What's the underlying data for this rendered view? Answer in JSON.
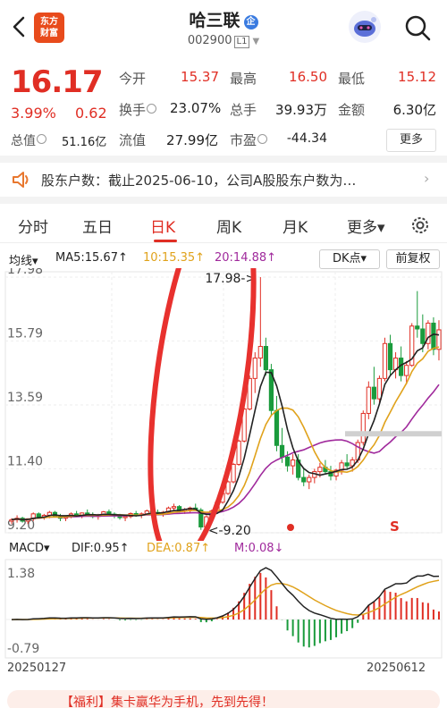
{
  "header": {
    "logo_line1": "东方",
    "logo_line2": "财富",
    "title": "哈三联",
    "title_badge": "企",
    "code": "002900",
    "level": "L1"
  },
  "quote": {
    "price": "16.17",
    "change_pct": "3.99%",
    "change_amt": "0.62",
    "open_label": "今开",
    "open": "15.37",
    "high_label": "最高",
    "high": "16.50",
    "low_label": "最低",
    "low": "15.12",
    "turnover_label": "换手",
    "turnover": "23.07%",
    "volume_label": "总手",
    "volume": "39.93万",
    "amount_label": "金额",
    "amount": "6.30亿",
    "mcap_label": "总值",
    "mcap": "51.16亿",
    "float_label": "流值",
    "float": "27.99亿",
    "pe_label": "市盈",
    "pe": "-44.34",
    "more": "更多"
  },
  "notice": {
    "text": "股东户数：截止2025-06-10，公司A股股东户数为…",
    "arrow": "›"
  },
  "tabs": [
    {
      "label": "分时"
    },
    {
      "label": "五日"
    },
    {
      "label": "日K"
    },
    {
      "label": "周K"
    },
    {
      "label": "月K"
    },
    {
      "label": "更多▾"
    }
  ],
  "indicators": {
    "ma_type": "均线▾",
    "ma5": "MA5:15.67↑",
    "ma10": "10:15.35↑",
    "ma20": "20:14.88↑",
    "dk": "DK点▾",
    "adjust": "前复权"
  },
  "macd": {
    "label": "MACD▾",
    "dif": "DIF:0.95↑",
    "dea": "DEA:0.87↑",
    "m": "M:0.08↓",
    "ymax": "1.38",
    "ymin": "-0.79"
  },
  "dates": {
    "start": "20250127",
    "end": "20250612"
  },
  "banner": "【福利】集卡赢华为手机，先到先得！",
  "chart_data": {
    "type": "candlestick",
    "y_ticks": [
      "17.98",
      "15.79",
      "13.59",
      "11.40",
      "9.20"
    ],
    "ylim": [
      9.2,
      17.98
    ],
    "annotations": {
      "high": "17.98->",
      "low": "<-9.20"
    },
    "signal": "S",
    "colors": {
      "up": "#e02e24",
      "down": "#1a9b3c",
      "ma5": "#222222",
      "ma10": "#e0a21b",
      "ma20": "#a02a9c"
    },
    "candles": [
      [
        9.6,
        9.7,
        9.5,
        9.65
      ],
      [
        9.65,
        9.8,
        9.55,
        9.7
      ],
      [
        9.7,
        9.75,
        9.55,
        9.6
      ],
      [
        9.6,
        9.7,
        9.5,
        9.68
      ],
      [
        9.68,
        9.9,
        9.6,
        9.85
      ],
      [
        9.85,
        9.9,
        9.7,
        9.75
      ],
      [
        9.75,
        9.85,
        9.65,
        9.8
      ],
      [
        9.8,
        9.95,
        9.7,
        9.9
      ],
      [
        9.9,
        9.95,
        9.75,
        9.78
      ],
      [
        9.78,
        9.85,
        9.6,
        9.7
      ],
      [
        9.7,
        9.8,
        9.6,
        9.75
      ],
      [
        9.75,
        9.9,
        9.7,
        9.85
      ],
      [
        9.85,
        9.95,
        9.75,
        9.8
      ],
      [
        9.8,
        9.9,
        9.7,
        9.88
      ],
      [
        9.88,
        10.0,
        9.8,
        9.82
      ],
      [
        9.82,
        9.9,
        9.7,
        9.76
      ],
      [
        9.76,
        9.85,
        9.65,
        9.8
      ],
      [
        9.8,
        9.95,
        9.75,
        9.92
      ],
      [
        9.92,
        10.0,
        9.8,
        9.84
      ],
      [
        9.84,
        9.9,
        9.7,
        9.78
      ],
      [
        9.78,
        9.85,
        9.65,
        9.72
      ],
      [
        9.72,
        9.8,
        9.6,
        9.76
      ],
      [
        9.76,
        9.9,
        9.7,
        9.86
      ],
      [
        9.86,
        9.95,
        9.75,
        9.8
      ],
      [
        9.8,
        9.9,
        9.7,
        9.85
      ],
      [
        9.85,
        10.0,
        9.8,
        9.95
      ],
      [
        9.95,
        10.05,
        9.85,
        9.9
      ],
      [
        9.9,
        10.0,
        9.8,
        9.86
      ],
      [
        9.86,
        9.95,
        9.75,
        9.9
      ],
      [
        9.9,
        10.1,
        9.85,
        10.05
      ],
      [
        10.05,
        10.2,
        9.95,
        10.1
      ],
      [
        10.1,
        10.15,
        9.9,
        9.95
      ],
      [
        9.95,
        10.05,
        9.85,
        10.0
      ],
      [
        10.0,
        10.1,
        9.9,
        10.05
      ],
      [
        10.05,
        10.2,
        9.95,
        9.98
      ],
      [
        9.98,
        10.05,
        9.3,
        9.4
      ],
      [
        9.4,
        9.8,
        9.2,
        9.75
      ],
      [
        9.75,
        10.0,
        9.7,
        9.95
      ],
      [
        9.95,
        10.3,
        9.9,
        10.25
      ],
      [
        10.25,
        10.6,
        10.2,
        10.55
      ],
      [
        10.55,
        11.0,
        10.5,
        10.95
      ],
      [
        10.95,
        11.6,
        10.9,
        11.55
      ],
      [
        11.55,
        12.4,
        11.5,
        12.35
      ],
      [
        12.35,
        13.5,
        12.3,
        13.45
      ],
      [
        13.45,
        14.6,
        13.4,
        14.5
      ],
      [
        14.5,
        15.4,
        14.0,
        15.2
      ],
      [
        15.2,
        17.98,
        14.9,
        15.6
      ],
      [
        15.6,
        15.9,
        14.6,
        14.8
      ],
      [
        14.8,
        15.0,
        13.2,
        13.4
      ],
      [
        13.4,
        13.9,
        12.0,
        12.2
      ],
      [
        12.2,
        12.8,
        11.6,
        11.8
      ],
      [
        11.8,
        12.0,
        11.3,
        11.5
      ],
      [
        11.5,
        11.9,
        11.2,
        11.7
      ],
      [
        11.7,
        11.9,
        11.0,
        11.1
      ],
      [
        11.1,
        11.4,
        10.8,
        10.95
      ],
      [
        10.95,
        11.2,
        10.7,
        11.1
      ],
      [
        11.1,
        11.4,
        10.9,
        11.3
      ],
      [
        11.3,
        11.6,
        11.1,
        11.45
      ],
      [
        11.45,
        11.7,
        11.2,
        11.3
      ],
      [
        11.3,
        11.5,
        11.0,
        11.15
      ],
      [
        11.15,
        11.4,
        11.0,
        11.35
      ],
      [
        11.35,
        11.7,
        11.2,
        11.6
      ],
      [
        11.6,
        11.9,
        11.4,
        11.5
      ],
      [
        11.5,
        11.8,
        11.3,
        11.7
      ],
      [
        11.7,
        12.4,
        11.6,
        12.3
      ],
      [
        12.3,
        13.4,
        12.2,
        13.3
      ],
      [
        13.3,
        14.4,
        13.1,
        14.2
      ],
      [
        14.2,
        14.9,
        13.6,
        13.8
      ],
      [
        13.8,
        14.6,
        13.6,
        14.5
      ],
      [
        14.5,
        15.9,
        14.4,
        15.7
      ],
      [
        15.7,
        16.0,
        14.6,
        14.8
      ],
      [
        14.8,
        15.4,
        14.5,
        15.2
      ],
      [
        15.2,
        15.6,
        14.4,
        14.6
      ],
      [
        14.6,
        15.1,
        14.3,
        14.95
      ],
      [
        14.95,
        16.4,
        14.9,
        16.3
      ],
      [
        16.3,
        17.5,
        15.9,
        16.2
      ],
      [
        16.2,
        16.7,
        15.4,
        15.7
      ],
      [
        15.7,
        16.5,
        15.5,
        16.4
      ],
      [
        16.4,
        16.6,
        15.3,
        15.5
      ],
      [
        15.5,
        16.5,
        15.12,
        16.17
      ]
    ]
  }
}
